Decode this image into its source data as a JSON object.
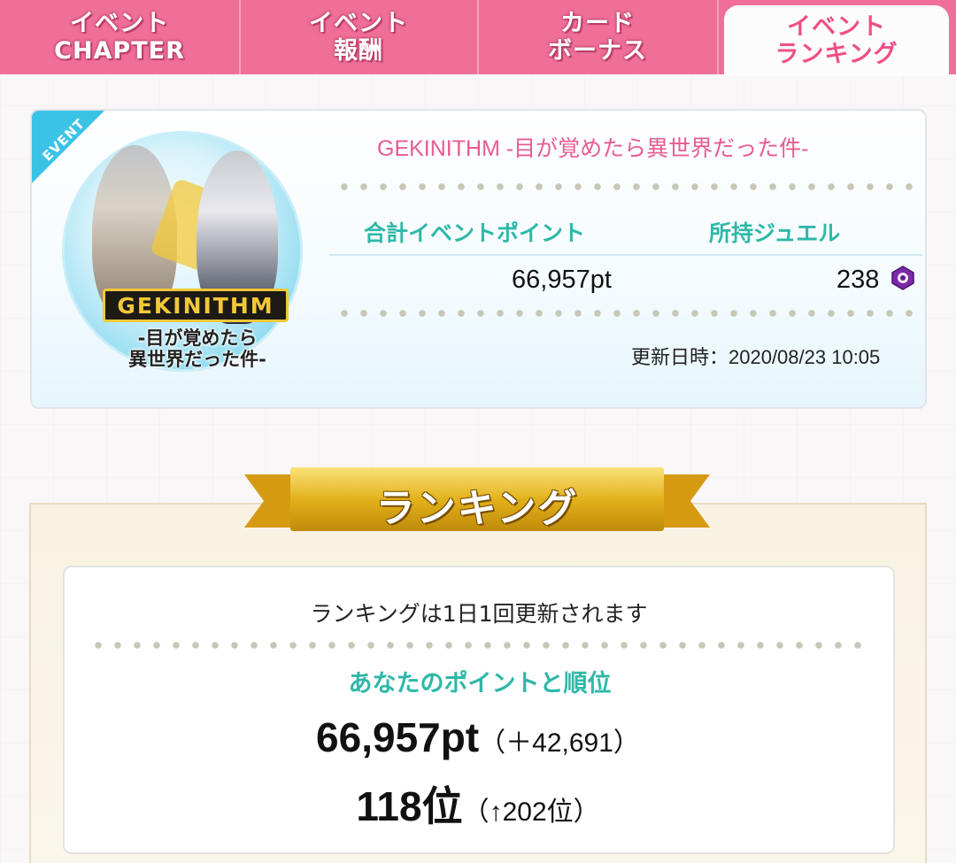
{
  "tabs": [
    {
      "line1": "イベント",
      "line2": "CHAPTER"
    },
    {
      "line1": "イベント",
      "line2": "報酬"
    },
    {
      "line1": "カード",
      "line2": "ボーナス"
    },
    {
      "line1": "イベント",
      "line2": "ランキング"
    }
  ],
  "event": {
    "tag": "EVENT",
    "title": "GEKINITHM -目が覚めたら異世界だった件-",
    "emblem_logo": "GEKINITHM",
    "emblem_sub_line1": "-目が覚めたら",
    "emblem_sub_line2": "異世界だった件-",
    "points_label": "合計イベントポイント",
    "jewel_label": "所持ジュエル",
    "points_value": "66,957pt",
    "jewel_value": "238",
    "jewel_icon": "jewel-icon",
    "updated": "更新日時：2020/08/23 10:05"
  },
  "ranking": {
    "ribbon": "ランキング",
    "note": "ランキングは1日1回更新されます",
    "subtitle": "あなたのポイントと順位",
    "points": "66,957pt",
    "points_delta": "（＋42,691）",
    "rank": "118位",
    "rank_delta": "（↑202位）"
  },
  "colors": {
    "tab_bg": "#ef6f98",
    "active_tab_text": "#ef4f86",
    "accent_teal": "#2fb8a8",
    "title_pink": "#e95c8e",
    "ribbon_gold": "#e2b21c"
  }
}
